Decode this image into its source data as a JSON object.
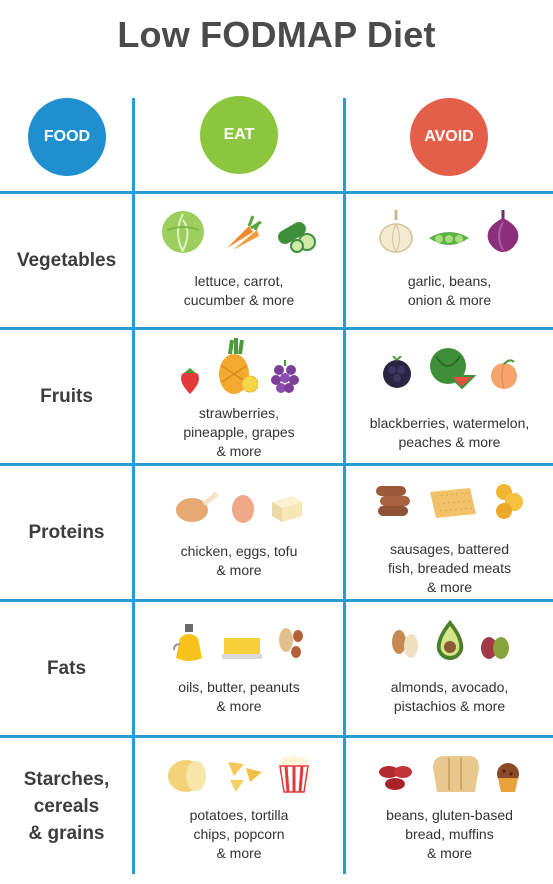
{
  "title": "Low FODMAP Diet",
  "headers": {
    "food": "FOOD",
    "eat": "EAT",
    "avoid": "AVOID"
  },
  "colors": {
    "food": "#1f8fd0",
    "eat": "#8cc63f",
    "avoid": "#e45f4a",
    "grid": "#2a9bd3"
  },
  "rows": [
    {
      "category": "Vegetables",
      "eat": {
        "text": "lettuce, carrot,\ncucumber & more",
        "icons": [
          "lettuce-icon",
          "carrot-icon",
          "cucumber-icon"
        ]
      },
      "avoid": {
        "text": "garlic, beans,\nonion & more",
        "icons": [
          "garlic-icon",
          "pea-pod-icon",
          "onion-icon"
        ]
      }
    },
    {
      "category": "Fruits",
      "eat": {
        "text": "strawberries,\npineapple, grapes\n& more",
        "icons": [
          "strawberry-icon",
          "pineapple-icon",
          "grapes-icon"
        ]
      },
      "avoid": {
        "text": "blackberries, watermelon,\npeaches & more",
        "icons": [
          "blackberry-icon",
          "watermelon-icon",
          "peach-icon"
        ]
      }
    },
    {
      "category": "Proteins",
      "eat": {
        "text": "chicken, eggs, tofu\n& more",
        "icons": [
          "chicken-icon",
          "egg-icon",
          "tofu-icon"
        ]
      },
      "avoid": {
        "text": "sausages, battered\nfish, breaded meats\n& more",
        "icons": [
          "sausage-icon",
          "battered-fish-icon",
          "breaded-meat-icon"
        ]
      }
    },
    {
      "category": "Fats",
      "eat": {
        "text": "oils, butter, peanuts\n& more",
        "icons": [
          "oil-bottle-icon",
          "butter-icon",
          "peanut-icon"
        ]
      },
      "avoid": {
        "text": "almonds, avocado,\npistachios & more",
        "icons": [
          "almond-icon",
          "avocado-icon",
          "pistachio-icon"
        ]
      }
    },
    {
      "category": "Starches,\ncereals\n& grains",
      "eat": {
        "text": "potatoes, tortilla\nchips, popcorn\n& more",
        "icons": [
          "potato-icon",
          "tortilla-chips-icon",
          "popcorn-icon"
        ]
      },
      "avoid": {
        "text": "beans, gluten-based\nbread, muffins\n& more",
        "icons": [
          "kidney-beans-icon",
          "bread-icon",
          "muffin-icon"
        ]
      }
    }
  ]
}
